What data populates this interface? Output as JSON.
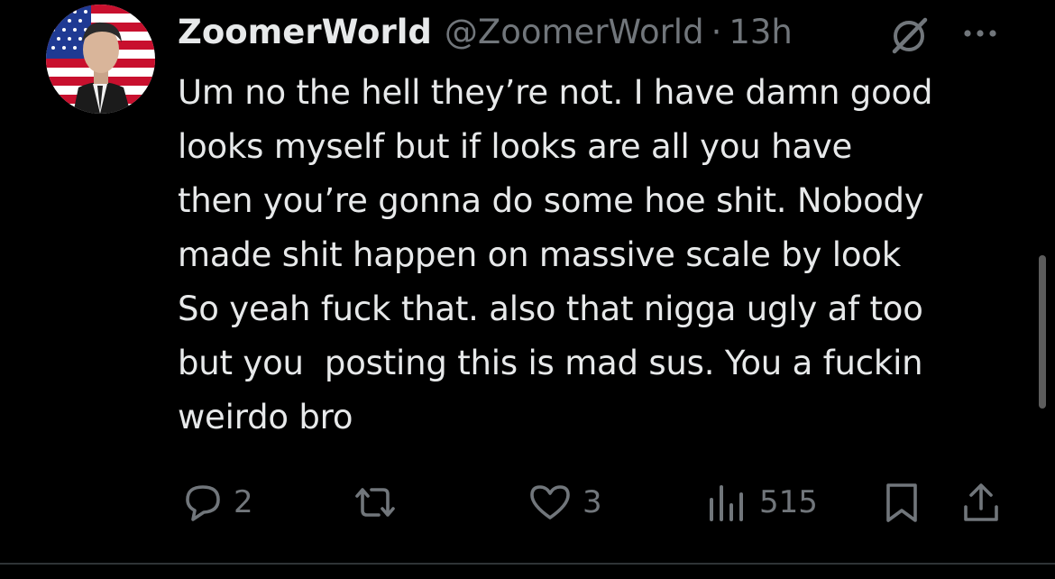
{
  "tweet": {
    "display_name": "ZoomerWorld",
    "handle": "@ZoomerWorld",
    "separator": "·",
    "time": "13h",
    "text": "Um no the hell they’re not. I have damn good\nlooks myself but if looks are all you have\nthen you’re gonna do some hoe shit. Nobody\nmade shit happen on massive scale by look\nSo yeah fuck that. also that nigga ugly af too\nbut you  posting this is mad sus. You a fuckin\nweirdo bro"
  },
  "icons": {
    "avatar": "avatar-us-flag-man",
    "grok": "grok-icon",
    "more": "more-dots-icon",
    "reply": "reply-icon",
    "repost": "repost-icon",
    "like": "heart-icon",
    "views": "views-icon",
    "bookmark": "bookmark-icon",
    "share": "share-icon"
  },
  "stats": {
    "replies": "2",
    "likes": "3",
    "views": "515"
  },
  "colors": {
    "background": "#000000",
    "text_primary": "#e7e9ea",
    "text_secondary": "#71767b",
    "divider": "#2f3336"
  }
}
